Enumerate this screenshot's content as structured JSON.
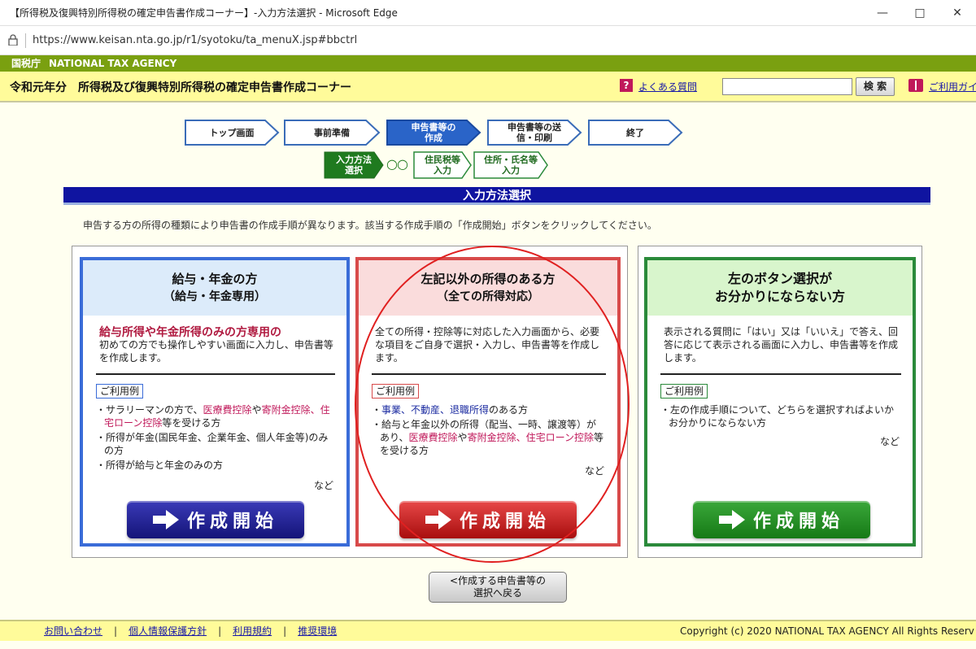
{
  "window": {
    "title": "【所得税及復興特別所得税の確定申告書作成コーナー】-入力方法選択 - Microsoft Edge",
    "url": "https://www.keisan.nta.go.jp/r1/syotoku/ta_menuX.jsp#bbctrl"
  },
  "agency": {
    "jp": "国税庁",
    "en": "NATIONAL TAX AGENCY"
  },
  "header": {
    "title": "令和元年分　所得税及び復興特別所得税の確定申告書作成コーナー",
    "faq_label": "よくある質問",
    "search_button": "検 索",
    "guide_label": "ご利用ガイ"
  },
  "steps": [
    {
      "label": "トップ画面"
    },
    {
      "label": "事前準備"
    },
    {
      "label": "申告書等の作成"
    },
    {
      "label": "申告書等の送信・印刷"
    },
    {
      "label": "終了"
    }
  ],
  "substeps": {
    "current": "入力方法選択",
    "dots": "○○",
    "items": [
      "住民税等入力",
      "住所・氏名等入力"
    ]
  },
  "section_title": "入力方法選択",
  "instructions": "申告する方の所得の種類により申告書の作成手順が異なります。該当する作成手順の「作成開始」ボタンをクリックしてください。",
  "cards": [
    {
      "title": "給与・年金の方",
      "subtitle": "（給与・年金専用）",
      "lead": "給与所得や年金所得のみの方専用の",
      "desc": "初めての方でも操作しやすい画面に入力し、申告書等を作成します。",
      "example_label": "ご利用例",
      "examples": [
        {
          "before": "サラリーマンの方で、",
          "red1": "医療費控除",
          "mid": "や",
          "red2": "寄附金控除、住宅ローン控除",
          "after": "等を受ける方"
        },
        {
          "text": "所得が年金(国民年金、企業年金、個人年金等)のみの方"
        },
        {
          "text": "所得が給与と年金のみの方"
        }
      ],
      "nado": "など",
      "button": "作成開始",
      "colors": {
        "border": "#3a6cd8",
        "head": "#dcebfa",
        "button": "#1a1a90"
      }
    },
    {
      "title": "左記以外の所得のある方",
      "subtitle": "（全ての所得対応）",
      "desc": "全ての所得・控除等に対応した入力画面から、必要な項目をご自身で選択・入力し、申告書等を作成します。",
      "example_label": "ご利用例",
      "examples": [
        {
          "blue": "事業、不動産、退職所得",
          "after": "のある方"
        },
        {
          "before": "給与と年金以外の所得（配当、一時、譲渡等）があり、",
          "red1": "医療費控除",
          "mid": "や",
          "red2": "寄附金控除、住宅ローン控除",
          "after": "等を受ける方"
        }
      ],
      "nado": "など",
      "button": "作成開始",
      "colors": {
        "border": "#d84a4a",
        "head": "#fadcdc",
        "button": "#c01818"
      }
    },
    {
      "title": "左のボタン選択が",
      "subtitle": "お分かりにならない方",
      "desc": "表示される質問に「はい」又は「いいえ」で答え、回答に応じて表示される画面に入力し、申告書等を作成します。",
      "example_label": "ご利用例",
      "examples": [
        {
          "text": "左の作成手順について、どちらを選択すればよいかお分かりにならない方"
        }
      ],
      "nado": "など",
      "button": "作成開始",
      "colors": {
        "border": "#2a8a3a",
        "head": "#d8f5cc",
        "button": "#1f8a2a"
      }
    }
  ],
  "back_button": {
    "line1": "<作成する申告書等の",
    "line2": "選択へ戻る"
  },
  "footer": {
    "links": [
      "お問い合わせ",
      "個人情報保護方針",
      "利用規約",
      "推奨環境"
    ],
    "separator": "|",
    "copyright": "Copyright (c) 2020 NATIONAL TAX AGENCY All Rights Reserv"
  }
}
